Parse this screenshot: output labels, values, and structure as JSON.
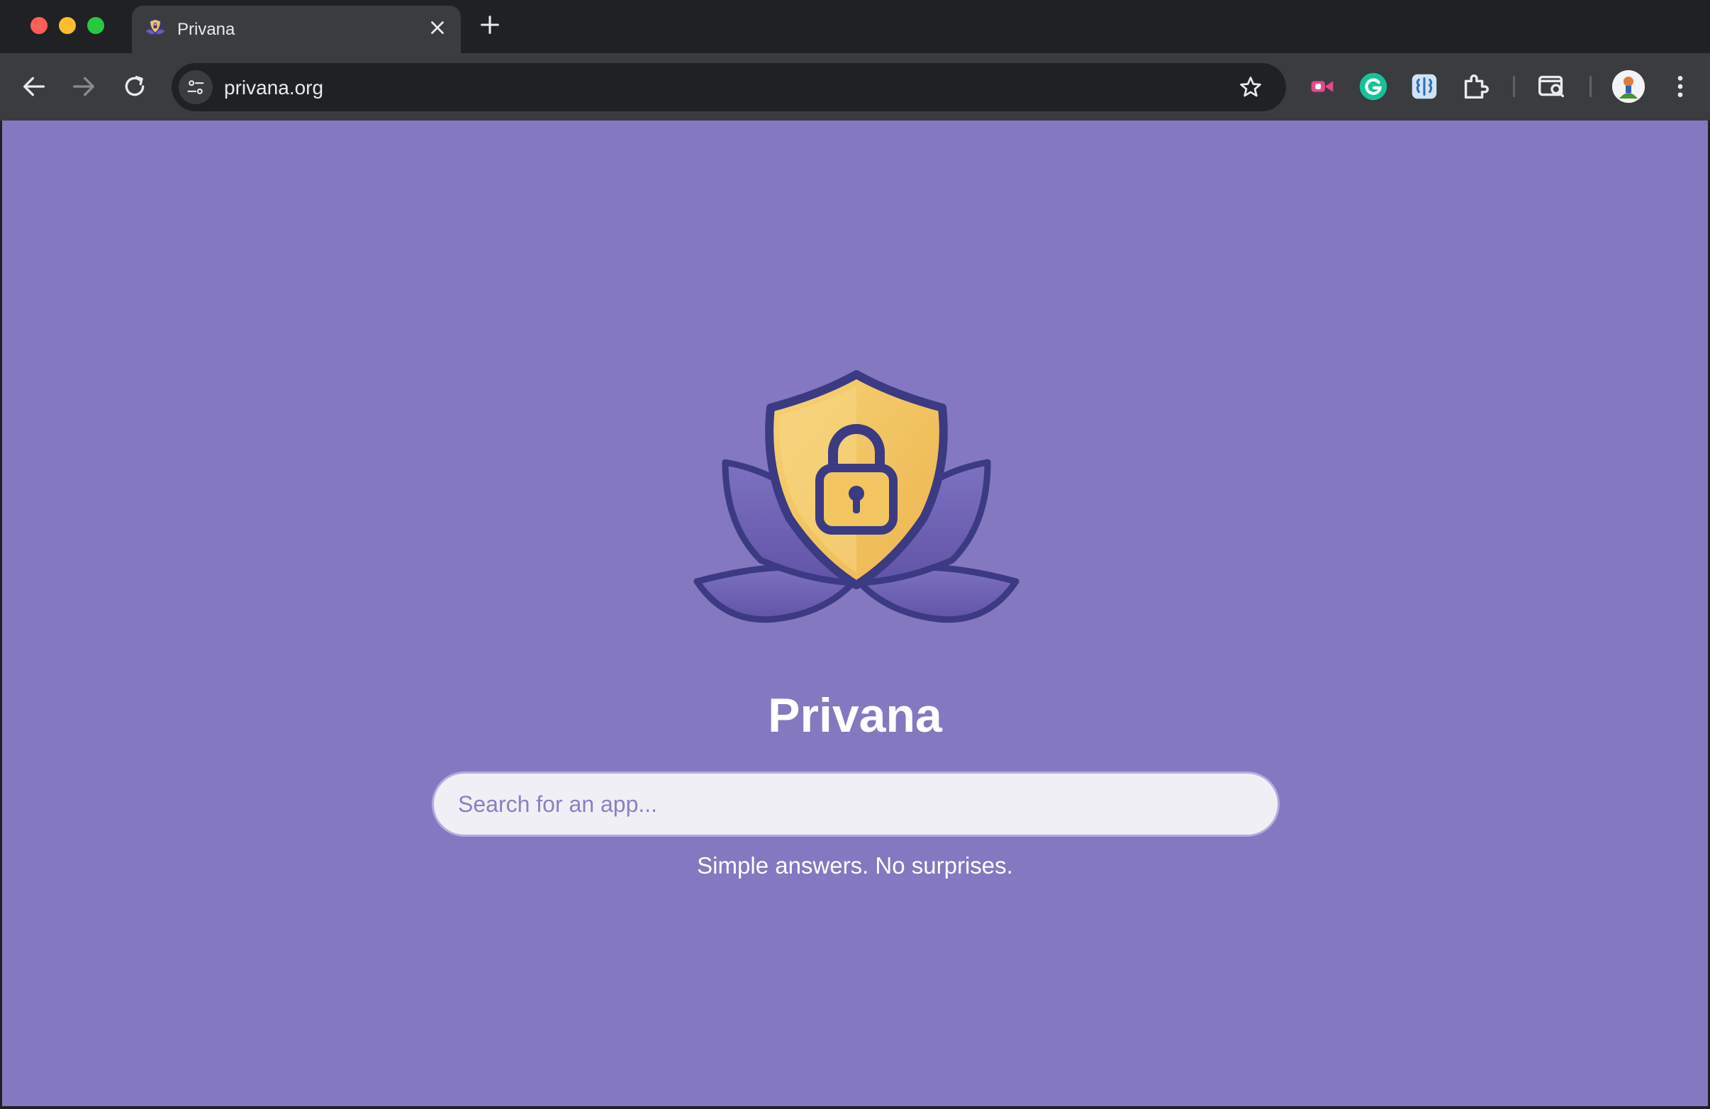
{
  "browser": {
    "tab": {
      "title": "Privana"
    },
    "address_bar": {
      "url": "privana.org"
    }
  },
  "page": {
    "brand_name": "Privana",
    "search": {
      "placeholder": "Search for an app...",
      "value": ""
    },
    "tagline": "Simple answers. No surprises."
  },
  "icons": {
    "nav": [
      "back-arrow-icon",
      "forward-arrow-icon",
      "reload-icon"
    ],
    "omnibox": [
      "site-info-icon",
      "bookmark-star-icon"
    ],
    "extensions": [
      "video-extension-icon",
      "grammarly-icon",
      "brain-extension-icon",
      "puzzle-extensions-icon",
      "tab-search-icon",
      "profile-avatar",
      "more-menu-icon"
    ]
  },
  "colors": {
    "page_background": "#8478c0",
    "shield_gold": "#f2c661",
    "outline_navy": "#3b3a83",
    "petal_purple": "#6b5fb2"
  }
}
